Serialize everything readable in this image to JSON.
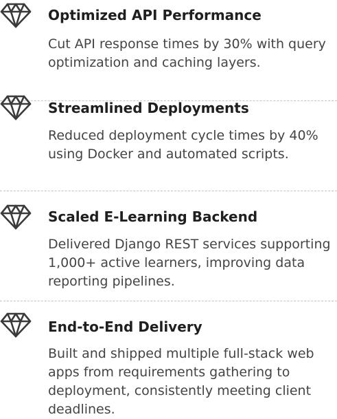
{
  "achievements": {
    "items": [
      {
        "icon": "diamond-icon",
        "title": "Optimized API Performance",
        "description": "Cut API response times by 30% with query optimization and caching layers."
      },
      {
        "icon": "diamond-icon",
        "title": "Streamlined Deployments",
        "description": "Reduced deployment cycle times by 40% using Docker and automated scripts."
      },
      {
        "icon": "diamond-icon",
        "title": "Scaled E-Learning Backend",
        "description": "Delivered Django REST services supporting 1,000+ active learners, improving data reporting pipelines."
      },
      {
        "icon": "diamond-icon",
        "title": "End-to-End Delivery",
        "description": "Built and shipped multiple full-stack web apps from requirements gathering to deployment, consistently meeting client deadlines."
      }
    ]
  },
  "colors": {
    "icon": "#3a3a3a",
    "title": "#1f1f1f",
    "text": "#444444",
    "divider": "#c4c4c4"
  }
}
